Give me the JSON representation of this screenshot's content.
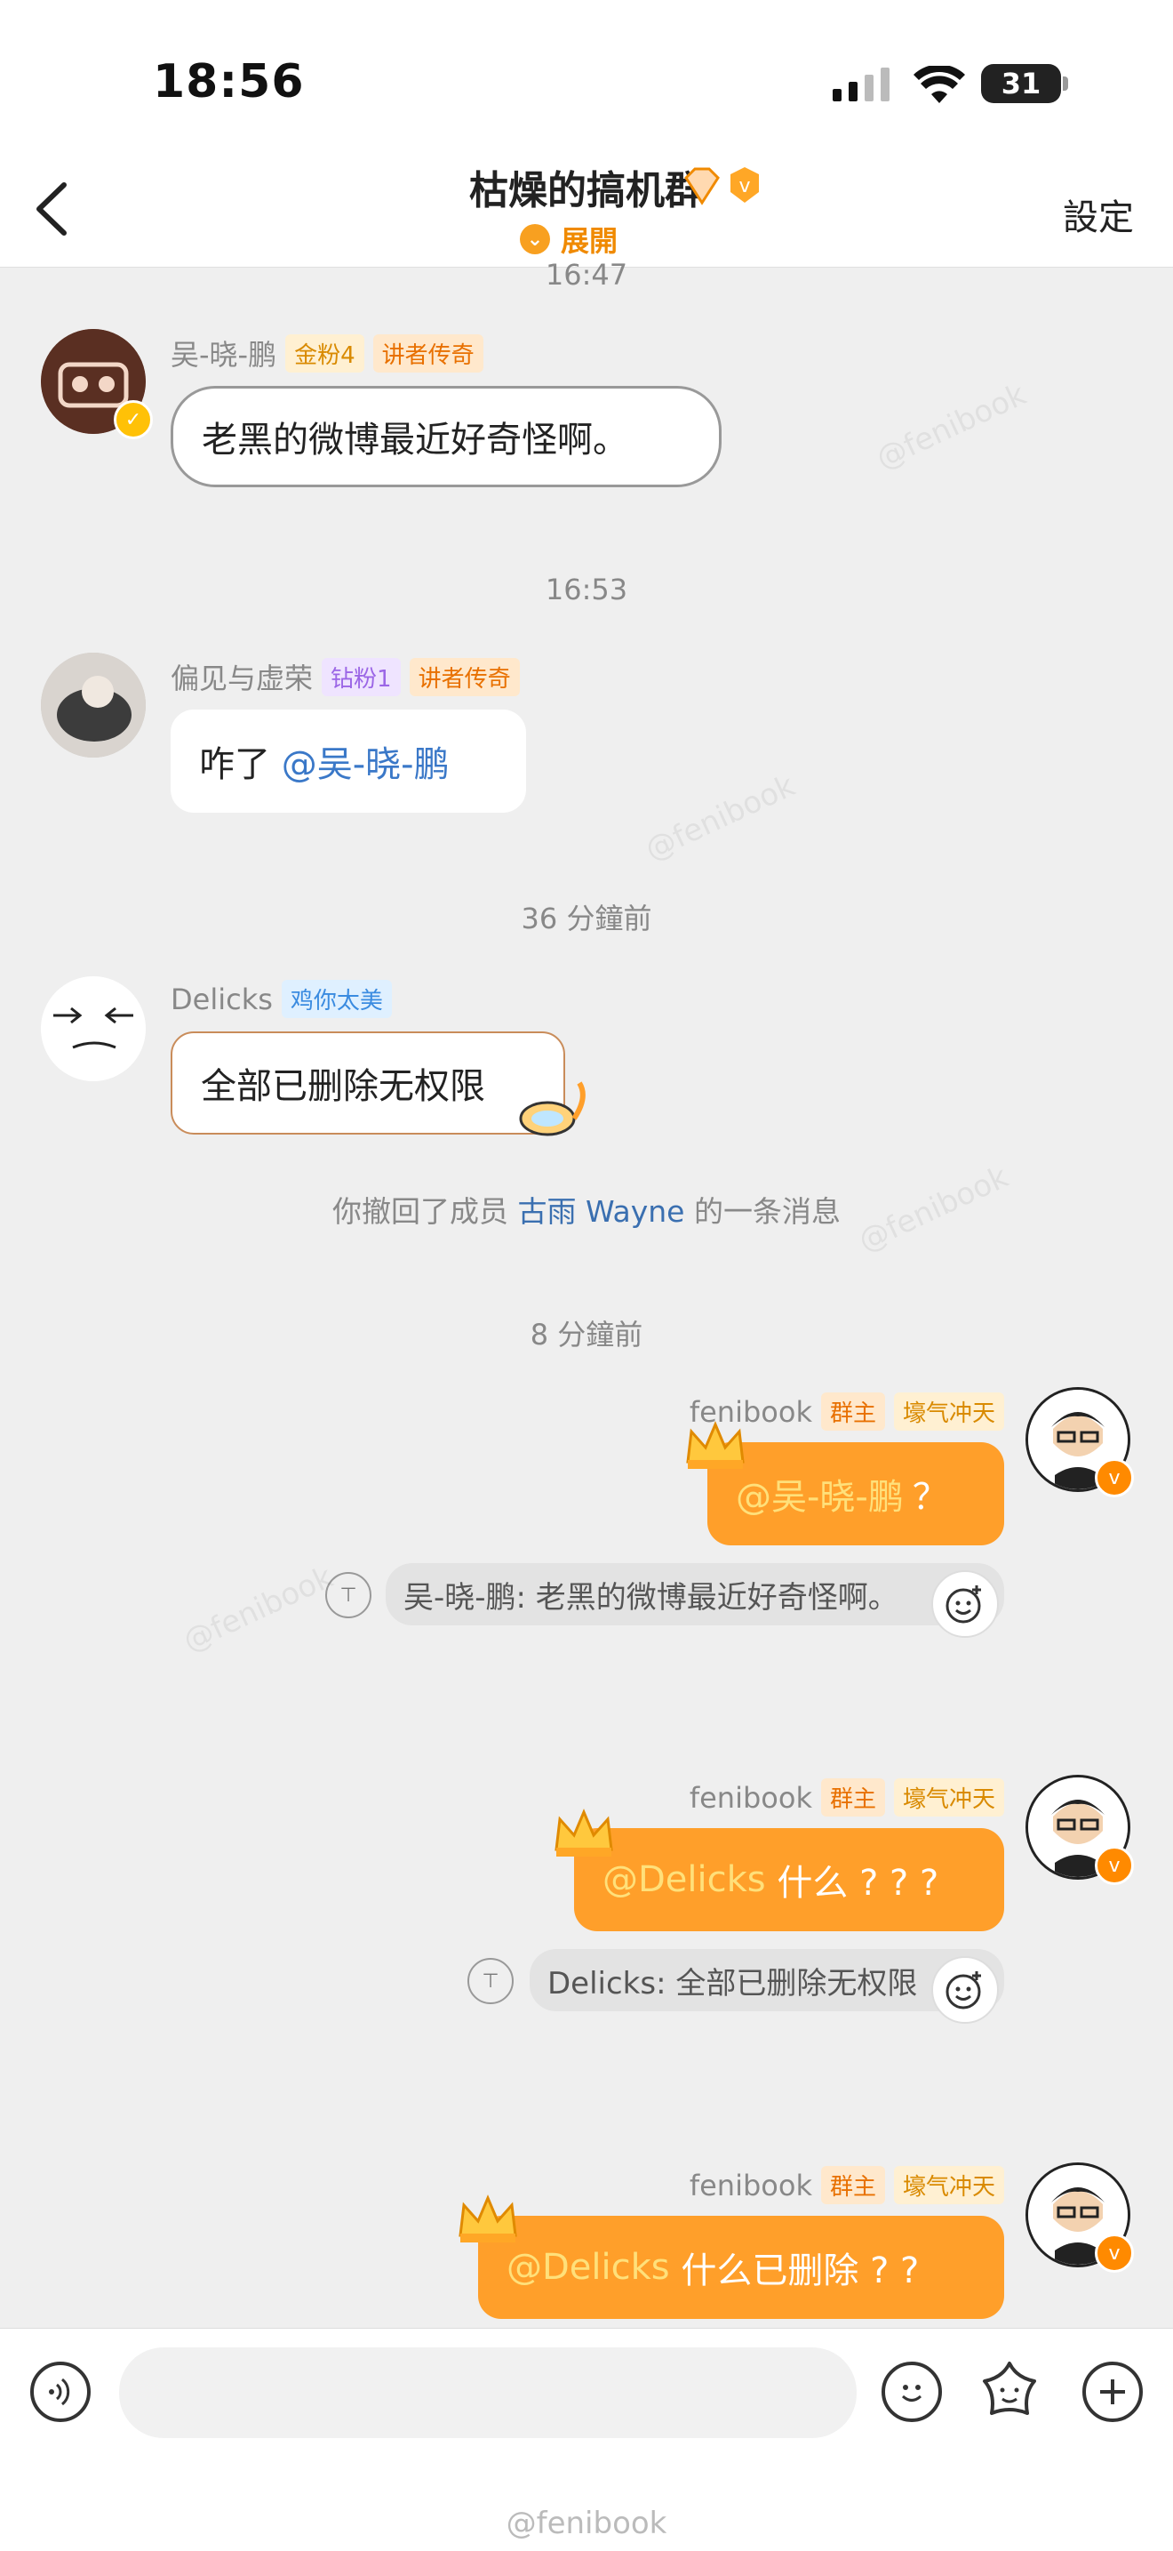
{
  "status": {
    "time": "18:56",
    "battery": "31"
  },
  "header": {
    "title": "枯燥的搞机群",
    "expand_label": "展開",
    "settings_label": "設定"
  },
  "messages": {
    "ts1": "16:47",
    "m1": {
      "name": "吴-晓-鹏",
      "tag1": "金粉4",
      "tag2": "讲者传奇",
      "text": "老黑的微博最近好奇怪啊。"
    },
    "ts2": "16:53",
    "m2": {
      "name": "偏见与虚荣",
      "tag1": "钻粉1",
      "tag2": "讲者传奇",
      "text_prefix": "咋了 ",
      "mention": "@吴-晓-鹏"
    },
    "ts3": "36 分鐘前",
    "m3": {
      "name": "Delicks",
      "tag1": "鸡你太美",
      "text": "全部已删除无权限"
    },
    "system": {
      "prefix": "你撤回了成员 ",
      "member": "古雨 Wayne",
      "suffix": " 的一条消息"
    },
    "ts4": "8 分鐘前",
    "m4": {
      "name": "fenibook",
      "tag1": "群主",
      "tag2": "壕气冲天",
      "mention": "@吴-晓-鹏",
      "text": "？",
      "quote": "吴-晓-鹏: 老黑的微博最近好奇怪啊。"
    },
    "m5": {
      "name": "fenibook",
      "tag1": "群主",
      "tag2": "壕气冲天",
      "mention": "@Delicks",
      "text": " 什么 ? ? ?",
      "quote": "Delicks: 全部已删除无权限"
    },
    "m6": {
      "name": "fenibook",
      "tag1": "群主",
      "tag2": "壕气冲天",
      "mention": "@Delicks",
      "text": " 什么已删除 ? ?"
    }
  },
  "watermark": "@fenibook",
  "footer_watermark": "@fenibook",
  "colors": {
    "accent": "#ff9f2a",
    "mention": "#3a78c8"
  },
  "icons": [
    "back-chevron-icon",
    "voice-icon",
    "emoji-icon",
    "sticker-icon",
    "plus-icon",
    "signal-icon",
    "wifi-icon",
    "reply-quote-icon",
    "add-reaction-icon"
  ]
}
